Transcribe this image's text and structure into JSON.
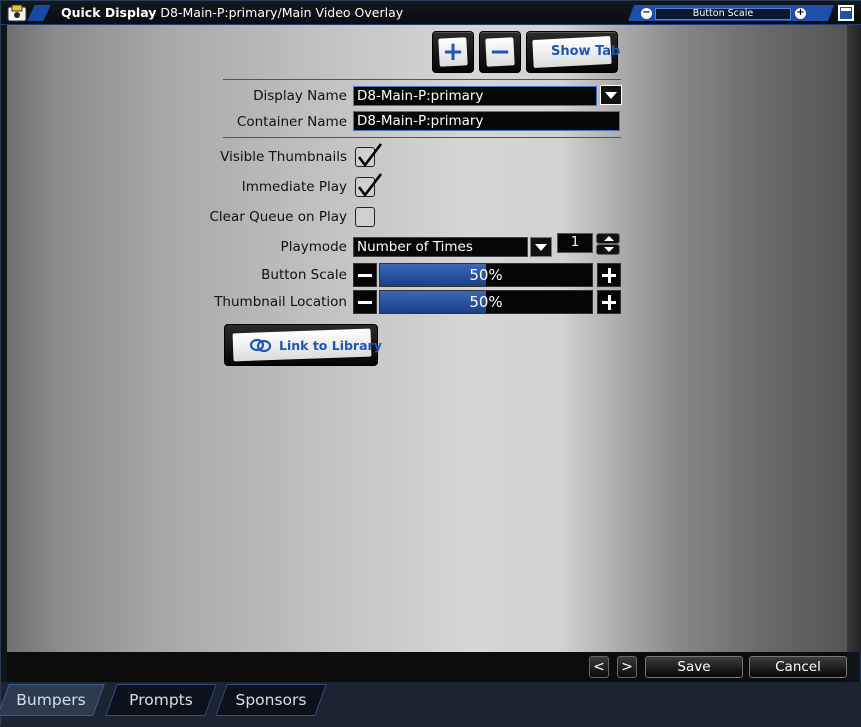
{
  "titlebar": {
    "app_name": "Quick Display",
    "document": "D8-Main-P:primary/Main Video Overlay",
    "scale_label": "Button Scale"
  },
  "toolbar": {
    "add_symbol": "+",
    "remove_symbol": "−",
    "show_tab_label": "Show Tab"
  },
  "form": {
    "display_name_label": "Display Name",
    "display_name_value": "D8-Main-P:primary",
    "container_name_label": "Container Name",
    "container_name_value": "D8-Main-P:primary",
    "visible_thumbnails_label": "Visible Thumbnails",
    "visible_thumbnails_checked": true,
    "immediate_play_label": "Immediate Play",
    "immediate_play_checked": true,
    "clear_queue_label": "Clear Queue on Play",
    "clear_queue_checked": false,
    "playmode_label": "Playmode",
    "playmode_value": "Number of Times",
    "playmode_count": "1",
    "button_scale_label": "Button Scale",
    "button_scale_value": "50%",
    "button_scale_fraction": 0.5,
    "thumbnail_location_label": "Thumbnail Location",
    "thumbnail_location_value": "50%",
    "thumbnail_location_fraction": 0.5,
    "link_library_label": "Link to Library"
  },
  "footer": {
    "prev_symbol": "<",
    "next_symbol": ">",
    "save_label": "Save",
    "cancel_label": "Cancel"
  },
  "tabs": [
    {
      "label": "Bumpers",
      "active": true
    },
    {
      "label": "Prompts",
      "active": false
    },
    {
      "label": "Sponsors",
      "active": false
    }
  ],
  "colors": {
    "accent": "#1f57b5",
    "slider_fill": "#2b58a8"
  }
}
